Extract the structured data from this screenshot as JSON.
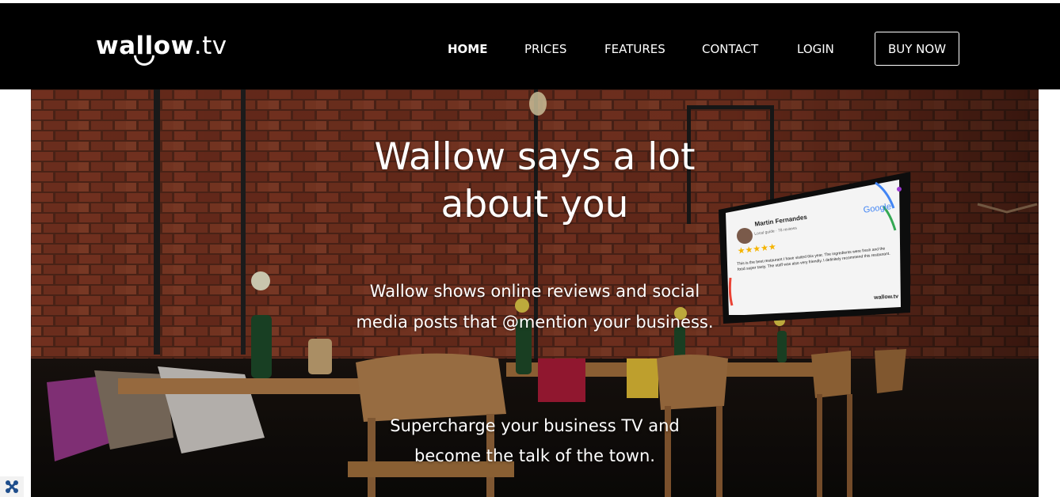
{
  "header": {
    "logo_bold": "wallow",
    "logo_light": ".tv",
    "nav": {
      "home": "HOME",
      "prices": "PRICES",
      "features": "FEATURES",
      "contact": "CONTACT",
      "login": "LOGIN",
      "buy_now": "BUY NOW"
    }
  },
  "hero": {
    "title": "Wallow says a lot\nabout you",
    "subtitle": "Wallow shows online reviews and social media posts that @mention your business.",
    "tagline": "Supercharge your business TV and become the talk of the town.",
    "tv_review": {
      "name": "Martin Fernandes",
      "meta": "Local guide · 78 reviews",
      "brand": "Google",
      "stars": "★★★★★",
      "text": "This is the best restaurant I have visited this year. The ingredients were fresh and the food super tasty. The staff was also very friendly. I definitely recommend this restaurant.",
      "footer": "wallow.tv"
    }
  },
  "corner_icon": "joomla-icon",
  "colors": {
    "nav_bg": "#000000",
    "nav_text": "#ffffff",
    "star": "#f5b400"
  }
}
